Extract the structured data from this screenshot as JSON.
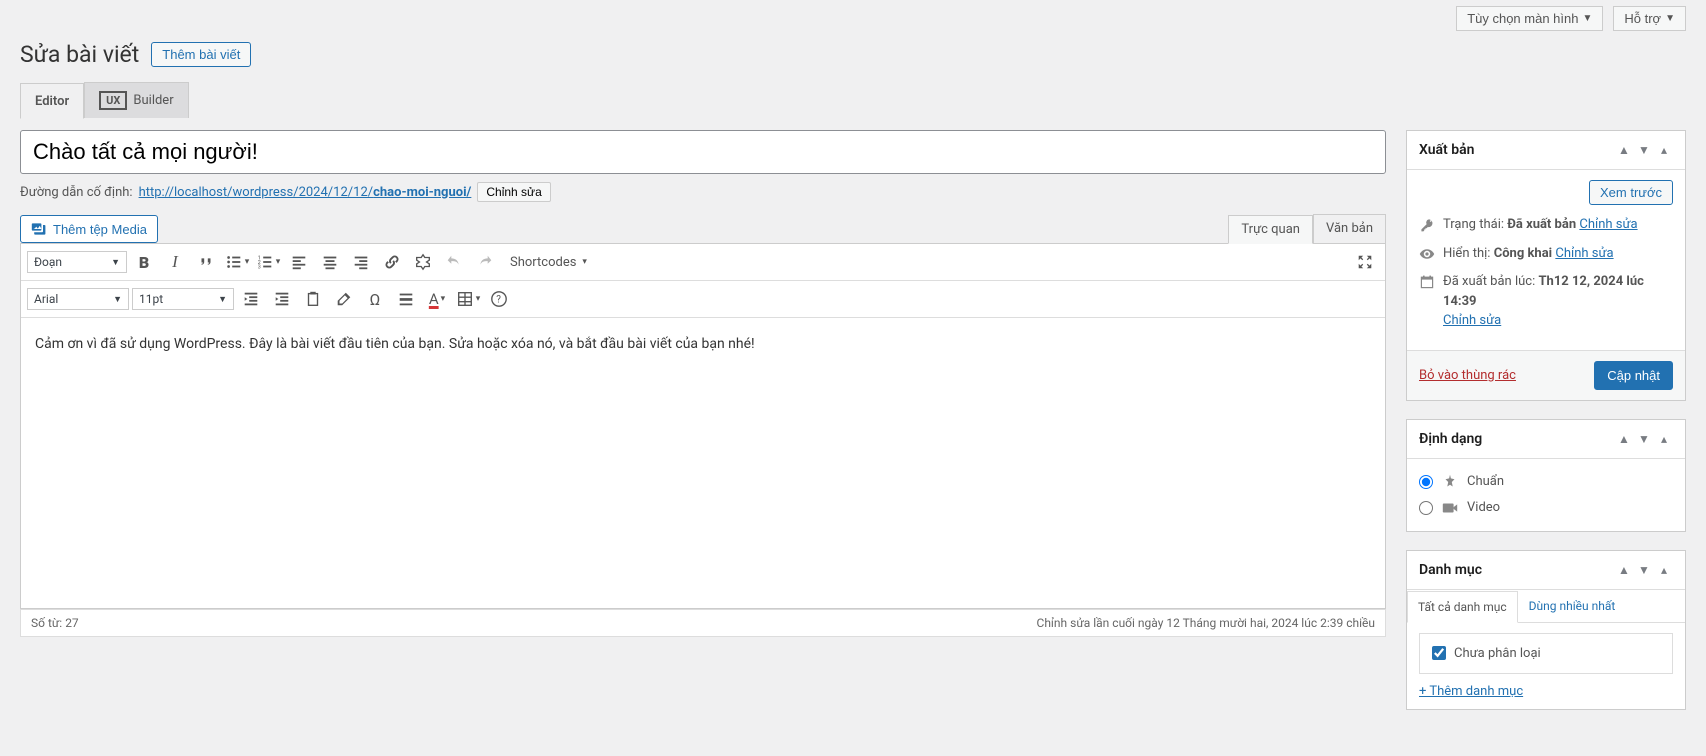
{
  "top": {
    "screen_options": "Tùy chọn màn hình",
    "help": "Hỗ trợ"
  },
  "header": {
    "title": "Sửa bài viết",
    "add_new": "Thêm bài viết"
  },
  "tabs": {
    "editor": "Editor",
    "ux": "UX",
    "builder": "Builder"
  },
  "post": {
    "title_value": "Chào tất cả mọi người!",
    "permalink_label": "Đường dẫn cố định:",
    "permalink_base": "http://localhost/wordpress/2024/12/12/",
    "permalink_slug": "chao-moi-nguoi/",
    "permalink_edit": "Chỉnh sửa",
    "add_media": "Thêm tệp Media",
    "tab_visual": "Trực quan",
    "tab_text": "Văn bản",
    "content": "Cảm ơn vì đã sử dụng WordPress. Đây là bài viết đầu tiên của bạn. Sửa hoặc xóa nó, và bắt đầu bài viết của bạn nhé!"
  },
  "toolbar": {
    "format_select": "Đoạn",
    "font_family": "Arial",
    "font_size": "11pt",
    "shortcodes": "Shortcodes"
  },
  "status": {
    "word_count_label": "Số từ:",
    "word_count": "27",
    "last_edit": "Chỉnh sửa lần cuối ngày 12 Tháng mười hai, 2024 lúc 2:39 chiều"
  },
  "publish": {
    "box_title": "Xuất bản",
    "preview": "Xem trước",
    "status_label": "Trạng thái:",
    "status_value": "Đã xuất bản",
    "status_edit": "Chỉnh sửa",
    "vis_label": "Hiển thị:",
    "vis_value": "Công khai",
    "vis_edit": "Chỉnh sửa",
    "pub_label": "Đã xuất bản lúc:",
    "pub_value": "Th12 12, 2024 lúc 14:39",
    "pub_edit": "Chỉnh sửa",
    "trash": "Bỏ vào thùng rác",
    "submit": "Cập nhật"
  },
  "format": {
    "box_title": "Định dạng",
    "standard": "Chuẩn",
    "video": "Video"
  },
  "category": {
    "box_title": "Danh mục",
    "tab_all": "Tất cả danh mục",
    "tab_used": "Dùng nhiều nhất",
    "uncat": "Chưa phân loại",
    "add": "+ Thêm danh mục"
  }
}
